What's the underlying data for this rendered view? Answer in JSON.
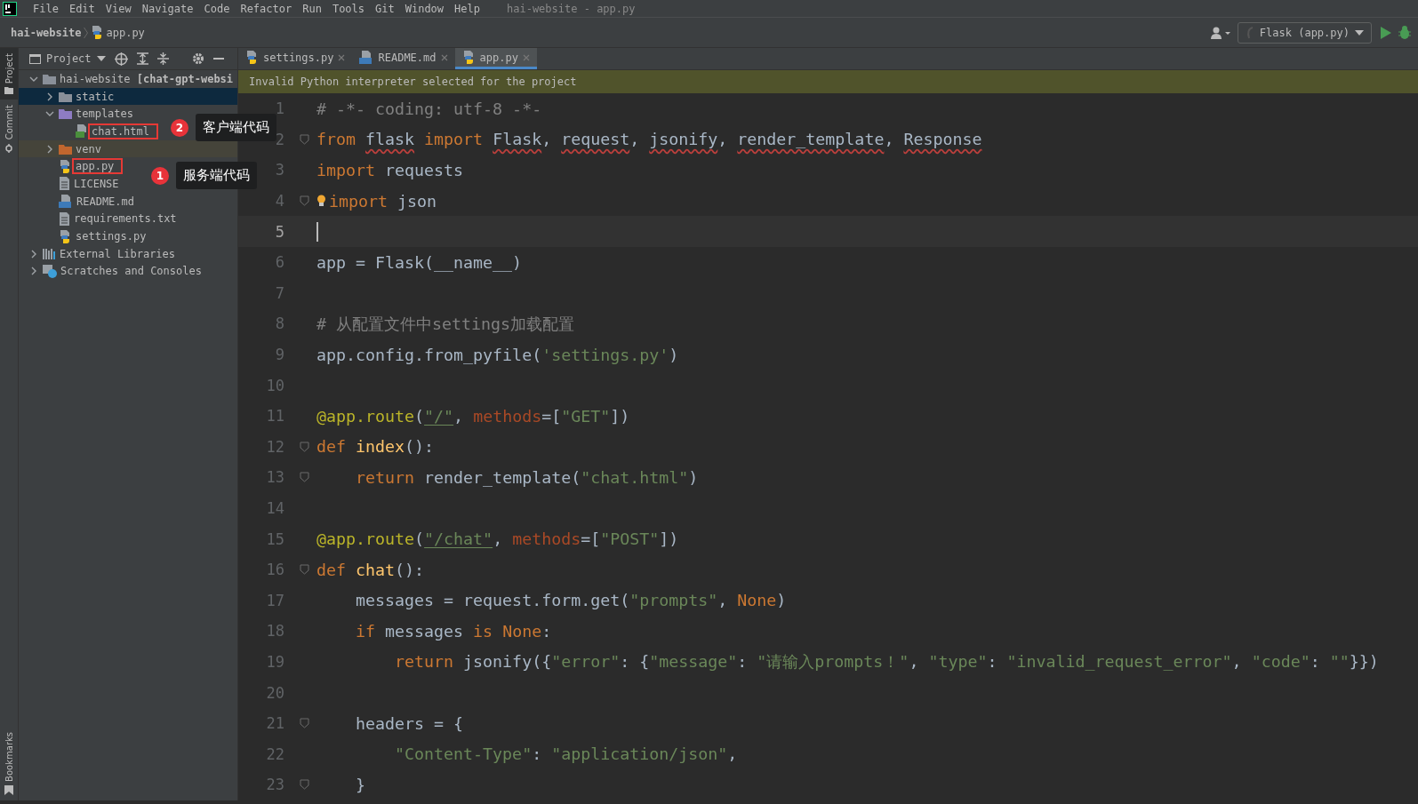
{
  "menu": {
    "items": [
      "File",
      "Edit",
      "View",
      "Navigate",
      "Code",
      "Refactor",
      "Run",
      "Tools",
      "Git",
      "Window",
      "Help"
    ],
    "title": "hai-website - app.py"
  },
  "navbar": {
    "breadcrumb": [
      "hai-website",
      "app.py"
    ],
    "run_config": "Flask (app.py)"
  },
  "side_strip": {
    "top": [
      "Project",
      "Commit"
    ],
    "bottom": [
      "Bookmarks"
    ]
  },
  "project": {
    "title": "Project",
    "tree": [
      {
        "label": "hai-website **[chat-gpt-websi**",
        "kind": "folder",
        "expanded": true,
        "selected": false,
        "boxed": false,
        "children": [
          {
            "label": "static",
            "kind": "folder",
            "expanded": false,
            "selected": true,
            "boxed": false
          },
          {
            "label": "templates",
            "kind": "template-folder",
            "expanded": true,
            "selected": false,
            "boxed": false,
            "children": [
              {
                "label": "chat.html",
                "kind": "html",
                "selected": false,
                "boxed": true
              }
            ]
          },
          {
            "label": "venv",
            "kind": "excluded-folder",
            "expanded": false,
            "selected": false,
            "boxed": false
          },
          {
            "label": "app.py",
            "kind": "python",
            "selected": false,
            "boxed": true
          },
          {
            "label": "LICENSE",
            "kind": "text",
            "selected": false,
            "boxed": false
          },
          {
            "label": "README.md",
            "kind": "markdown",
            "selected": false,
            "boxed": false
          },
          {
            "label": "requirements.txt",
            "kind": "text",
            "selected": false,
            "boxed": false
          },
          {
            "label": "settings.py",
            "kind": "python",
            "selected": false,
            "boxed": false
          }
        ]
      },
      {
        "label": "External Libraries",
        "kind": "libraries",
        "expanded": false,
        "selected": false,
        "boxed": false
      },
      {
        "label": "Scratches and Consoles",
        "kind": "scratches",
        "expanded": false,
        "selected": false,
        "boxed": false
      }
    ]
  },
  "annotations": [
    {
      "number": "2",
      "text": "客户端代码"
    },
    {
      "number": "1",
      "text": "服务端代码"
    }
  ],
  "tabs": [
    {
      "label": "settings.py",
      "kind": "python",
      "selected": false
    },
    {
      "label": "README.md",
      "kind": "markdown",
      "selected": false
    },
    {
      "label": "app.py",
      "kind": "python",
      "selected": true
    }
  ],
  "banner": "Invalid Python interpreter selected for the project",
  "lines": [
    {
      "number": "1",
      "current": false,
      "fold": false,
      "bulb": false,
      "tokens": [
        {
          "kind": "comment",
          "text": "# -*- coding: utf-8 -*-"
        }
      ]
    },
    {
      "number": "2",
      "current": false,
      "fold": true,
      "bulb": false,
      "tokens": [
        {
          "kind": "keyword",
          "text": "from "
        },
        {
          "kind": "unresolved",
          "text": "flask"
        },
        {
          "kind": "keyword",
          "text": " import "
        },
        {
          "kind": "unresolved",
          "text": "Flask"
        },
        {
          "kind": "plain",
          "text": ", "
        },
        {
          "kind": "unresolved",
          "text": "request"
        },
        {
          "kind": "plain",
          "text": ", "
        },
        {
          "kind": "unresolved",
          "text": "jsonify"
        },
        {
          "kind": "plain",
          "text": ", "
        },
        {
          "kind": "unresolved",
          "text": "render_template"
        },
        {
          "kind": "plain",
          "text": ", "
        },
        {
          "kind": "unresolved",
          "text": "Response"
        }
      ]
    },
    {
      "number": "3",
      "current": false,
      "fold": false,
      "bulb": false,
      "tokens": [
        {
          "kind": "keyword",
          "text": "import "
        },
        {
          "kind": "plain",
          "text": "requests"
        }
      ]
    },
    {
      "number": "4",
      "current": false,
      "fold": true,
      "bulb": true,
      "tokens": [
        {
          "kind": "keyword",
          "text": "import "
        },
        {
          "kind": "plain",
          "text": "json"
        }
      ]
    },
    {
      "number": "5",
      "current": true,
      "fold": false,
      "bulb": false
    },
    {
      "number": "6",
      "current": false,
      "fold": false,
      "bulb": false,
      "tokens": [
        {
          "kind": "plain",
          "text": "app = Flask(__name__)"
        }
      ]
    },
    {
      "number": "7",
      "current": false,
      "fold": false,
      "bulb": false
    },
    {
      "number": "8",
      "current": false,
      "fold": false,
      "bulb": false,
      "tokens": [
        {
          "kind": "comment",
          "text": "# 从配置文件中settings加载配置"
        }
      ]
    },
    {
      "number": "9",
      "current": false,
      "fold": false,
      "bulb": false,
      "tokens": [
        {
          "kind": "plain",
          "text": "app.config.from_pyfile("
        },
        {
          "kind": "string",
          "text": "'settings.py'"
        },
        {
          "kind": "plain",
          "text": ")"
        }
      ]
    },
    {
      "number": "10",
      "current": false,
      "fold": false,
      "bulb": false
    },
    {
      "number": "11",
      "current": false,
      "fold": false,
      "bulb": false,
      "tokens": [
        {
          "kind": "decorator",
          "text": "@app.route"
        },
        {
          "kind": "plain",
          "text": "("
        },
        {
          "kind": "link",
          "text": "\"/\""
        },
        {
          "kind": "plain",
          "text": ", "
        },
        {
          "kind": "kwarg",
          "text": "methods"
        },
        {
          "kind": "plain",
          "text": "=["
        },
        {
          "kind": "string",
          "text": "\"GET\""
        },
        {
          "kind": "plain",
          "text": "])"
        }
      ]
    },
    {
      "number": "12",
      "current": false,
      "fold": true,
      "bulb": false,
      "tokens": [
        {
          "kind": "keyword",
          "text": "def "
        },
        {
          "kind": "func",
          "text": "index"
        },
        {
          "kind": "plain",
          "text": "():"
        }
      ]
    },
    {
      "number": "13",
      "current": false,
      "fold": true,
      "bulb": false,
      "tokens": [
        {
          "kind": "keyword",
          "text": "    return "
        },
        {
          "kind": "plain",
          "text": "render_template("
        },
        {
          "kind": "string",
          "text": "\"chat.html\""
        },
        {
          "kind": "plain",
          "text": ")"
        }
      ]
    },
    {
      "number": "14",
      "current": false,
      "fold": false,
      "bulb": false
    },
    {
      "number": "15",
      "current": false,
      "fold": false,
      "bulb": false,
      "tokens": [
        {
          "kind": "decorator",
          "text": "@app.route"
        },
        {
          "kind": "plain",
          "text": "("
        },
        {
          "kind": "link",
          "text": "\"/chat\""
        },
        {
          "kind": "plain",
          "text": ", "
        },
        {
          "kind": "kwarg",
          "text": "methods"
        },
        {
          "kind": "plain",
          "text": "=["
        },
        {
          "kind": "string",
          "text": "\"POST\""
        },
        {
          "kind": "plain",
          "text": "])"
        }
      ]
    },
    {
      "number": "16",
      "current": false,
      "fold": true,
      "bulb": false,
      "tokens": [
        {
          "kind": "keyword",
          "text": "def "
        },
        {
          "kind": "func",
          "text": "chat"
        },
        {
          "kind": "plain",
          "text": "():"
        }
      ]
    },
    {
      "number": "17",
      "current": false,
      "fold": false,
      "bulb": false,
      "tokens": [
        {
          "kind": "plain",
          "text": "    messages = request.form.get("
        },
        {
          "kind": "string",
          "text": "\"prompts\""
        },
        {
          "kind": "plain",
          "text": ", "
        },
        {
          "kind": "keyword",
          "text": "None"
        },
        {
          "kind": "plain",
          "text": ")"
        }
      ]
    },
    {
      "number": "18",
      "current": false,
      "fold": false,
      "bulb": false,
      "tokens": [
        {
          "kind": "keyword",
          "text": "    if "
        },
        {
          "kind": "plain",
          "text": "messages "
        },
        {
          "kind": "keyword",
          "text": "is None"
        },
        {
          "kind": "plain",
          "text": ":"
        }
      ]
    },
    {
      "number": "19",
      "current": false,
      "fold": false,
      "bulb": false,
      "tokens": [
        {
          "kind": "keyword",
          "text": "        return "
        },
        {
          "kind": "plain",
          "text": "jsonify({"
        },
        {
          "kind": "string",
          "text": "\"error\""
        },
        {
          "kind": "plain",
          "text": ": {"
        },
        {
          "kind": "string",
          "text": "\"message\""
        },
        {
          "kind": "plain",
          "text": ": "
        },
        {
          "kind": "string",
          "text": "\"请输入prompts！\""
        },
        {
          "kind": "plain",
          "text": ", "
        },
        {
          "kind": "string",
          "text": "\"type\""
        },
        {
          "kind": "plain",
          "text": ": "
        },
        {
          "kind": "string",
          "text": "\"invalid_request_error\""
        },
        {
          "kind": "plain",
          "text": ", "
        },
        {
          "kind": "string",
          "text": "\"code\""
        },
        {
          "kind": "plain",
          "text": ": "
        },
        {
          "kind": "string",
          "text": "\"\""
        },
        {
          "kind": "plain",
          "text": "}})"
        }
      ]
    },
    {
      "number": "20",
      "current": false,
      "fold": false,
      "bulb": false
    },
    {
      "number": "21",
      "current": false,
      "fold": true,
      "bulb": false,
      "tokens": [
        {
          "kind": "plain",
          "text": "    headers = {"
        }
      ]
    },
    {
      "number": "22",
      "current": false,
      "fold": false,
      "bulb": false,
      "tokens": [
        {
          "kind": "string",
          "text": "        \"Content-Type\""
        },
        {
          "kind": "plain",
          "text": ": "
        },
        {
          "kind": "string",
          "text": "\"application/json\""
        },
        {
          "kind": "plain",
          "text": ","
        }
      ]
    },
    {
      "number": "23",
      "current": false,
      "fold": true,
      "bulb": false,
      "tokens": [
        {
          "kind": "plain",
          "text": "    }"
        }
      ]
    }
  ]
}
